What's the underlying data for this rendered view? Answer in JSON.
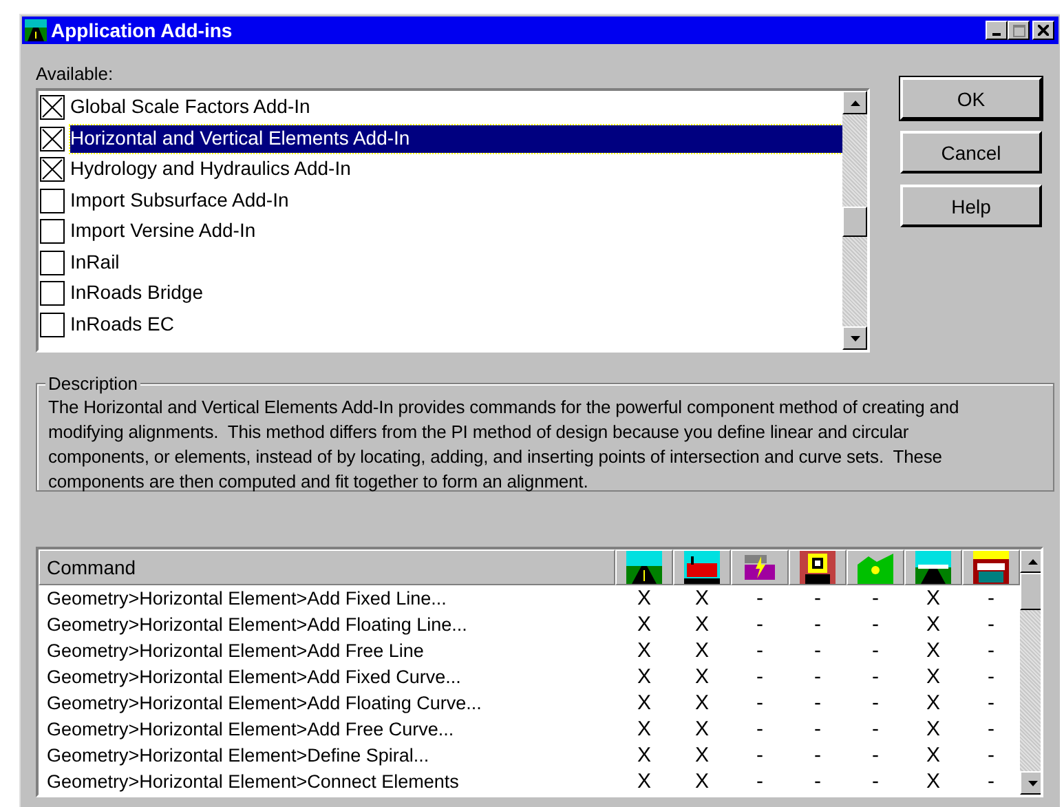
{
  "window": {
    "title": "Application Add-ins"
  },
  "available": {
    "label": "Available:",
    "items": [
      {
        "label": "Global Scale Factors Add-In",
        "checked": true,
        "selected": false
      },
      {
        "label": "Horizontal and Vertical Elements Add-In",
        "checked": true,
        "selected": true
      },
      {
        "label": "Hydrology and Hydraulics Add-In",
        "checked": true,
        "selected": false
      },
      {
        "label": "Import Subsurface Add-In",
        "checked": false,
        "selected": false
      },
      {
        "label": "Import Versine Add-In",
        "checked": false,
        "selected": false
      },
      {
        "label": "InRail",
        "checked": false,
        "selected": false
      },
      {
        "label": "InRoads Bridge",
        "checked": false,
        "selected": false
      },
      {
        "label": "InRoads EC",
        "checked": false,
        "selected": false
      }
    ]
  },
  "buttons": [
    {
      "label": "OK",
      "default": true
    },
    {
      "label": "Cancel",
      "default": false
    },
    {
      "label": "Help",
      "default": false
    }
  ],
  "description": {
    "title": "Description",
    "text": "The Horizontal and Vertical Elements Add-In provides commands for the powerful component method of creating and modifying alignments.  This method differs from the PI method of design because you define linear and circular components, or elements, instead of by locating, adding, and inserting points of intersection and curve sets.  These components are then computed and fit together to form an alignment."
  },
  "table": {
    "command_header": "Command",
    "rows": [
      {
        "command": "Geometry>Horizontal Element>Add Fixed Line...",
        "marks": [
          "X",
          "X",
          "-",
          "-",
          "-",
          "X",
          "-"
        ]
      },
      {
        "command": "Geometry>Horizontal Element>Add Floating Line...",
        "marks": [
          "X",
          "X",
          "-",
          "-",
          "-",
          "X",
          "-"
        ]
      },
      {
        "command": "Geometry>Horizontal Element>Add Free Line",
        "marks": [
          "X",
          "X",
          "-",
          "-",
          "-",
          "X",
          "-"
        ]
      },
      {
        "command": "Geometry>Horizontal Element>Add Fixed Curve...",
        "marks": [
          "X",
          "X",
          "-",
          "-",
          "-",
          "X",
          "-"
        ]
      },
      {
        "command": "Geometry>Horizontal Element>Add Floating Curve...",
        "marks": [
          "X",
          "X",
          "-",
          "-",
          "-",
          "X",
          "-"
        ]
      },
      {
        "command": "Geometry>Horizontal Element>Add Free Curve...",
        "marks": [
          "X",
          "X",
          "-",
          "-",
          "-",
          "X",
          "-"
        ]
      },
      {
        "command": "Geometry>Horizontal Element>Define Spiral...",
        "marks": [
          "X",
          "X",
          "-",
          "-",
          "-",
          "X",
          "-"
        ]
      },
      {
        "command": "Geometry>Horizontal Element>Connect Elements",
        "marks": [
          "X",
          "X",
          "-",
          "-",
          "-",
          "X",
          "-"
        ]
      }
    ]
  }
}
